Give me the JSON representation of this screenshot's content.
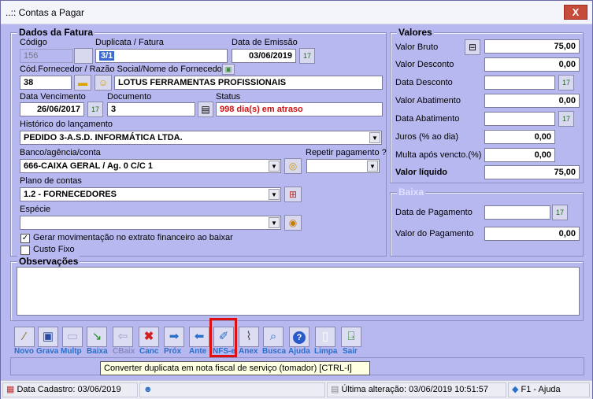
{
  "window": {
    "title": "..:: Contas a Pagar",
    "close_label": "X"
  },
  "fatura": {
    "legend": "Dados da Fatura",
    "codigo_label": "Código",
    "codigo": "156",
    "duplicata_label": "Duplicata / Fatura",
    "duplicata": "3/1",
    "emissao_label": "Data de Emissão",
    "emissao": "03/06/2019",
    "fornecedor_label": "Cód.Fornecedor / Razão Social/Nome do Fornecedor",
    "fornecedor_cod": "38",
    "fornecedor_nome": "LOTUS FERRAMENTAS PROFISSIONAIS",
    "vencimento_label": "Data Vencimento",
    "vencimento": "26/06/2017",
    "documento_label": "Documento",
    "documento": "3",
    "status_label": "Status",
    "status": "998 dia(s) em atraso",
    "historico_label": "Histórico do lançamento",
    "historico": "PEDIDO 3-A.S.D. INFORMÁTICA LTDA.",
    "banco_label": "Banco/agência/conta",
    "banco": "666-CAIXA GERAL / Ag. 0 C/C 1",
    "repetir_label": "Repetir pagamento ?",
    "repetir": "",
    "plano_label": "Plano de contas",
    "plano": "1.2 - FORNECEDORES",
    "especie_label": "Espécie",
    "especie": "",
    "gerar_label": "Gerar movimentação no extrato financeiro ao baixar",
    "custo_label": "Custo Fixo"
  },
  "valores": {
    "legend": "Valores",
    "bruto_label": "Valor Bruto",
    "bruto": "75,00",
    "desconto_label": "Valor Desconto",
    "desconto": "0,00",
    "data_desconto_label": "Data Desconto",
    "data_desconto": "",
    "abatimento_label": "Valor Abatimento",
    "abatimento": "0,00",
    "data_abatimento_label": "Data Abatimento",
    "data_abatimento": "",
    "juros_label": "Juros (% ao dia)",
    "juros": "0,00",
    "multa_label": "Multa após vencto.(%)",
    "multa": "0,00",
    "liquido_label": "Valor líquido",
    "liquido": "75,00"
  },
  "baixa": {
    "legend": "Baixa",
    "data_label": "Data de Pagamento",
    "data": "",
    "valor_label": "Valor do Pagamento",
    "valor": "0,00"
  },
  "observacoes": {
    "legend": "Observações",
    "text": ""
  },
  "toolbar": {
    "novo": "Novo",
    "grava": "Grava",
    "multp": "Multp",
    "baixa": "Baixa",
    "cbaix": "CBaix",
    "canc": "Canc",
    "prox": "Próx",
    "ante": "Ante",
    "nfse": "NFS-e",
    "anex": "Anex",
    "busca": "Busca",
    "ajuda": "Ajuda",
    "limpa": "Limpa",
    "sair": "Sair"
  },
  "tooltip": "Converter duplicata em nota fiscal de serviço (tomador) [CTRL-I]",
  "statusbar": {
    "cadastro": "Data Cadastro: 03/06/2019",
    "alteracao": "Última alteração: 03/06/2019 10:51:57",
    "ajuda": "F1 - Ajuda"
  }
}
